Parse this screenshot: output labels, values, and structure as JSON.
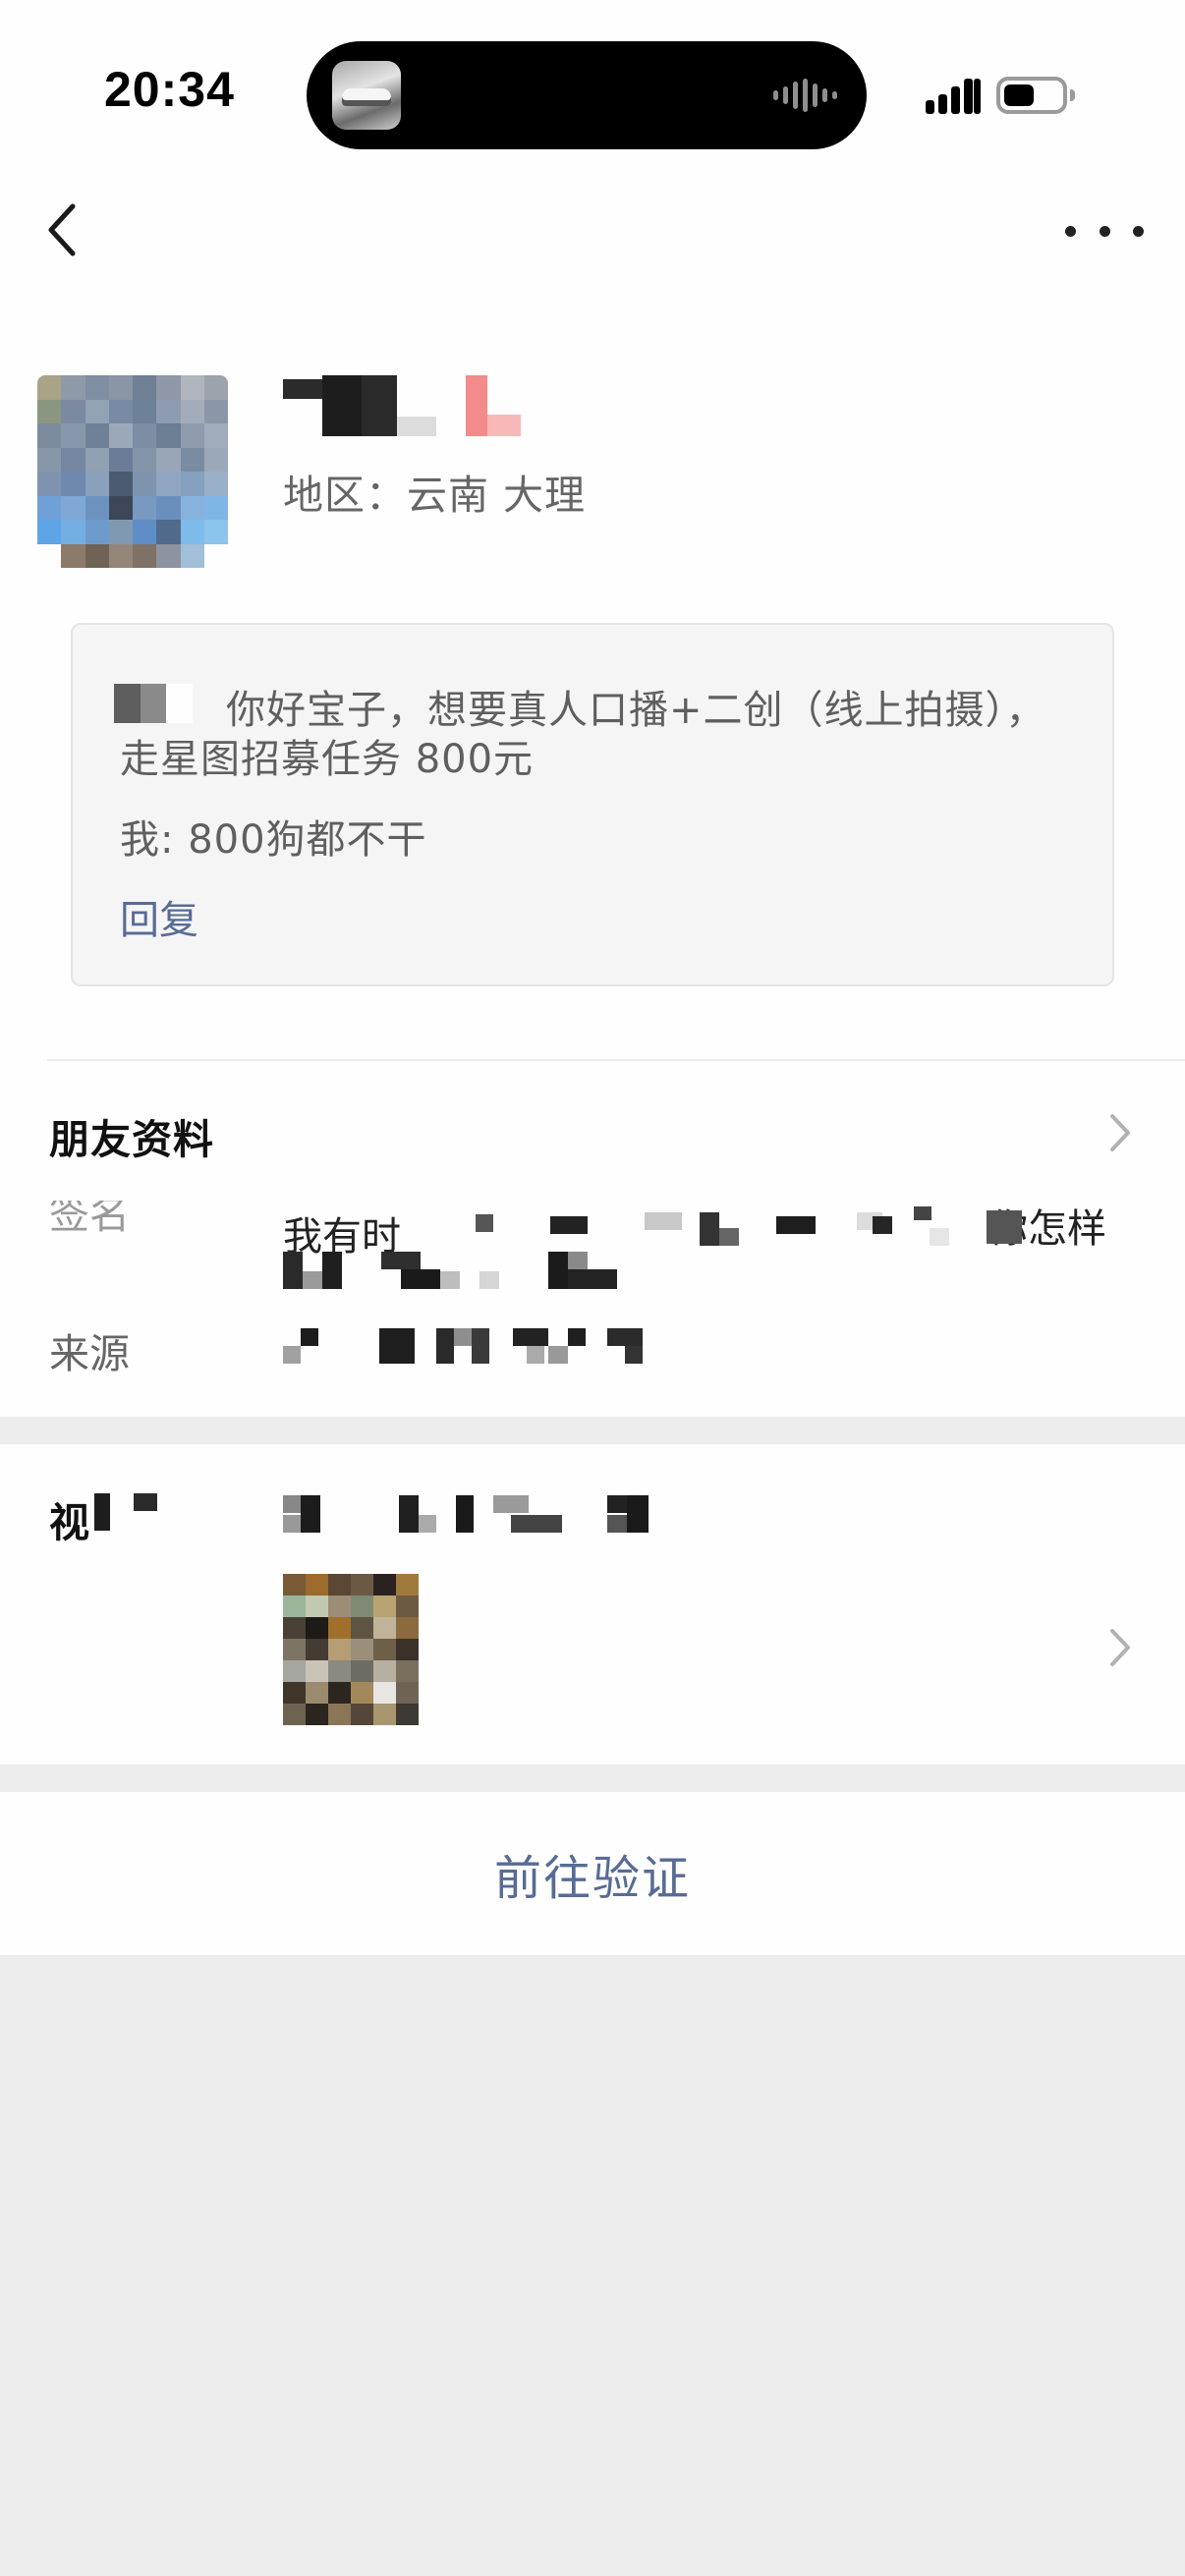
{
  "status_bar": {
    "time": "20:34"
  },
  "nav": {
    "back_icon": "chevron-left-icon",
    "more_icon": "ellipsis-icon"
  },
  "profile": {
    "region": "地区：云南 大理"
  },
  "greeting": {
    "line1": "你好宝子，想要真人口播+二创（线上拍摄），",
    "line2": "走星图招募任务 800元",
    "my_reply": "我: 800狗都不干",
    "reply_link": "回复"
  },
  "friend_info": {
    "title": "朋友资料",
    "signature_label": "签名",
    "signature_start": "我有时",
    "signature_end": "你怎样",
    "source_label": "来源"
  },
  "video_section": {
    "label": "视"
  },
  "verify": {
    "button_label": "前往验证"
  },
  "colors": {
    "link_blue": "#576b95",
    "page_bg": "#ededed",
    "card_bg": "#fefefe"
  }
}
